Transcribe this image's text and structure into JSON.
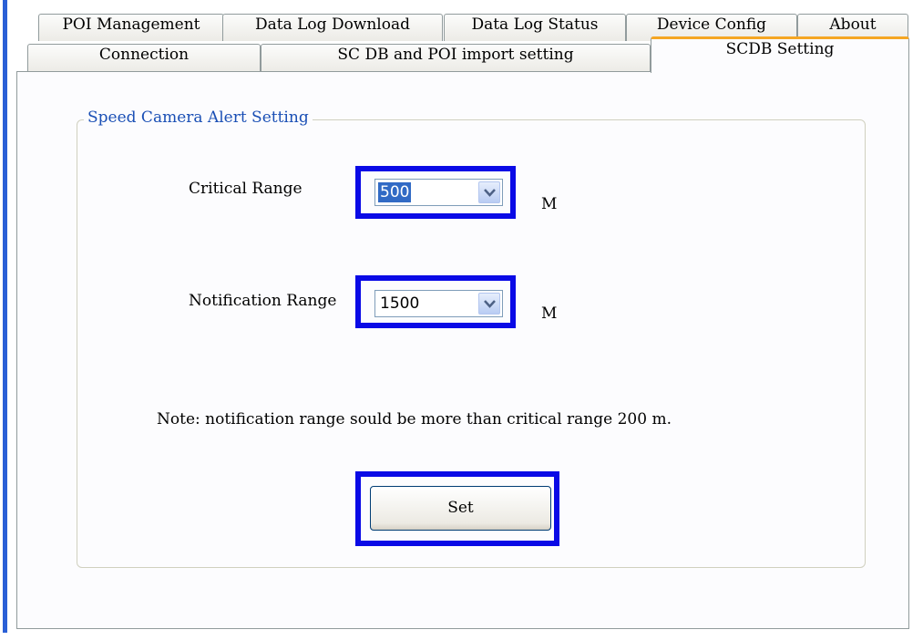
{
  "tabs_back_row": [
    {
      "label": "POI Management"
    },
    {
      "label": "Data Log Download"
    },
    {
      "label": "Data Log Status"
    },
    {
      "label": "Device Config"
    },
    {
      "label": "About"
    }
  ],
  "tabs_front_row": [
    {
      "label": "Connection"
    },
    {
      "label": "SC DB and POI import setting"
    },
    {
      "label": "SCDB Setting",
      "active": true
    }
  ],
  "group": {
    "label": "Speed Camera Alert Setting"
  },
  "critical": {
    "label": "Critical Range",
    "value": "500",
    "unit": "M"
  },
  "notification": {
    "label": "Notification Range",
    "value": "1500",
    "unit": "M"
  },
  "note": "Note: notification range sould be more than  critical range 200 m.",
  "set_button": {
    "label": "Set"
  },
  "colors": {
    "highlight": "#0a0ae6",
    "active_tab_accent": "#f5a623",
    "group_label": "#1a4fb5"
  }
}
